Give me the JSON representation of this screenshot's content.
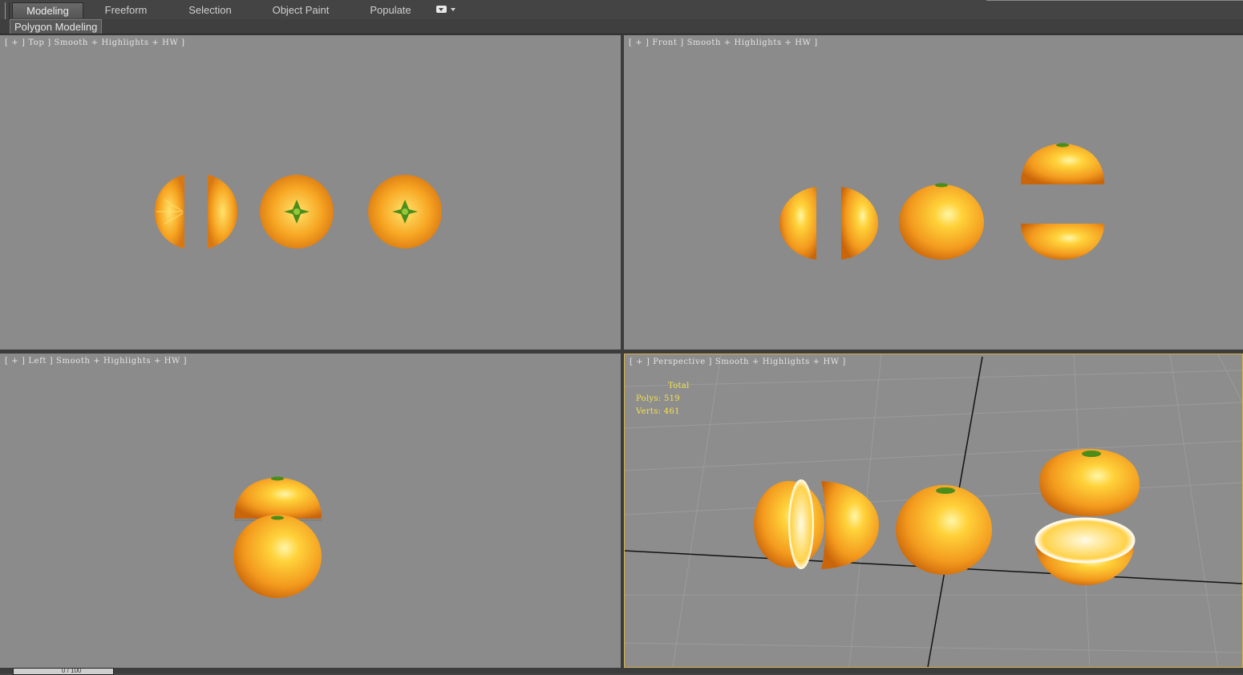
{
  "ribbon": {
    "tabs": [
      {
        "label": "Modeling",
        "active": true
      },
      {
        "label": "Freeform",
        "active": false
      },
      {
        "label": "Selection",
        "active": false
      },
      {
        "label": "Object Paint",
        "active": false
      },
      {
        "label": "Populate",
        "active": false
      }
    ],
    "options_icon": "ribbon-display-options-icon"
  },
  "panel": {
    "tab_label": "Polygon Modeling"
  },
  "viewports": {
    "top": {
      "label": "[ + ] Top ] Smooth + Highlights + HW ]"
    },
    "front": {
      "label": "[ + ] Front ] Smooth + Highlights + HW ]"
    },
    "left": {
      "label": "[ + ] Left ] Smooth + Highlights + HW ]"
    },
    "perspective": {
      "label": "[ + ] Perspective ] Smooth + Highlights + HW ]",
      "stats": {
        "title": "Total",
        "polys": "Polys: 519",
        "verts": "Verts: 461"
      }
    }
  },
  "timeline": {
    "frame_label": "0 / 100"
  },
  "colors": {
    "viewport_bg": "#8b8b8b",
    "active_viewport_border": "#d4b24a",
    "stats_text": "#f5e34a",
    "orange": "#f39a1e"
  }
}
